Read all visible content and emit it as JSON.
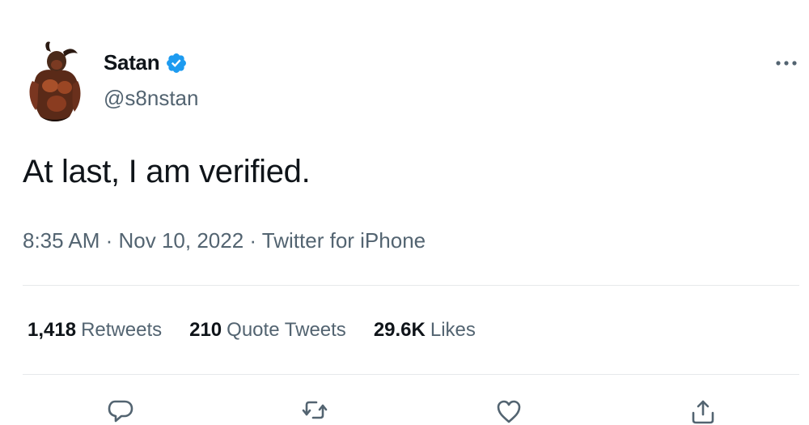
{
  "author": {
    "name": "Satan",
    "handle": "@s8nstan",
    "verified": true
  },
  "tweet": {
    "text": "At last, I am verified.",
    "time": "8:35 AM",
    "date": "Nov 10, 2022",
    "source": "Twitter for iPhone",
    "meta_line": "8:35 AM · Nov 10, 2022 · Twitter for iPhone"
  },
  "stats": {
    "retweets": {
      "count": "1,418",
      "label": "Retweets"
    },
    "quote_tweets": {
      "count": "210",
      "label": "Quote Tweets"
    },
    "likes": {
      "count": "29.6K",
      "label": "Likes"
    }
  },
  "icons": {
    "verified": "verified-badge-icon",
    "more": "more-options-icon",
    "reply": "reply-icon",
    "retweet": "retweet-icon",
    "like": "heart-icon",
    "share": "share-icon"
  },
  "colors": {
    "verified": "#1d9bf0",
    "primary_text": "#0f1419",
    "secondary_text": "#536471"
  }
}
